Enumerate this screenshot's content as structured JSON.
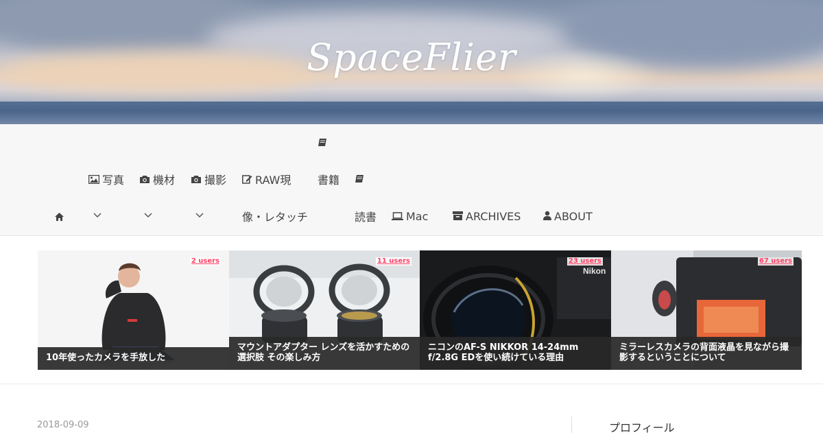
{
  "header": {
    "brand": "SpaceFlier"
  },
  "nav": {
    "home_icon": "home-icon",
    "items": [
      {
        "icon": "image-icon",
        "label": "写真"
      },
      {
        "icon": "camera-icon",
        "label": "機材"
      },
      {
        "icon": "camera-icon",
        "label": "撮影"
      },
      {
        "icon": "edit-icon",
        "label": "RAW現",
        "label2": "像・レタッチ"
      },
      {
        "icon": "book-icon",
        "label": "書籍"
      },
      {
        "icon": "book-icon",
        "label": "読書"
      },
      {
        "icon": "laptop-icon",
        "label": "Mac"
      },
      {
        "icon": "archive-icon",
        "label": "ARCHIVES"
      },
      {
        "icon": "user-icon",
        "label": "ABOUT"
      }
    ]
  },
  "cards": [
    {
      "users": "2 users",
      "caption": "10年使ったカメラを手放した"
    },
    {
      "users": "11 users",
      "caption": "マウントアダプター レンズを活かすための選択肢 その楽しみ方"
    },
    {
      "users": "23 users",
      "caption": "ニコンのAF-S NIKKOR 14-24mm f/2.8G EDを使い続けている理由"
    },
    {
      "users": "67 users",
      "caption": "ミラーレスカメラの背面液晶を見ながら撮影するということについて"
    }
  ],
  "post": {
    "date": "2018-09-09"
  },
  "sidebar": {
    "title": "プロフィール"
  },
  "colors": {
    "nav_bg": "#f7f7f7",
    "users_badge": "#ff4166",
    "caption_bg": "#282828"
  }
}
